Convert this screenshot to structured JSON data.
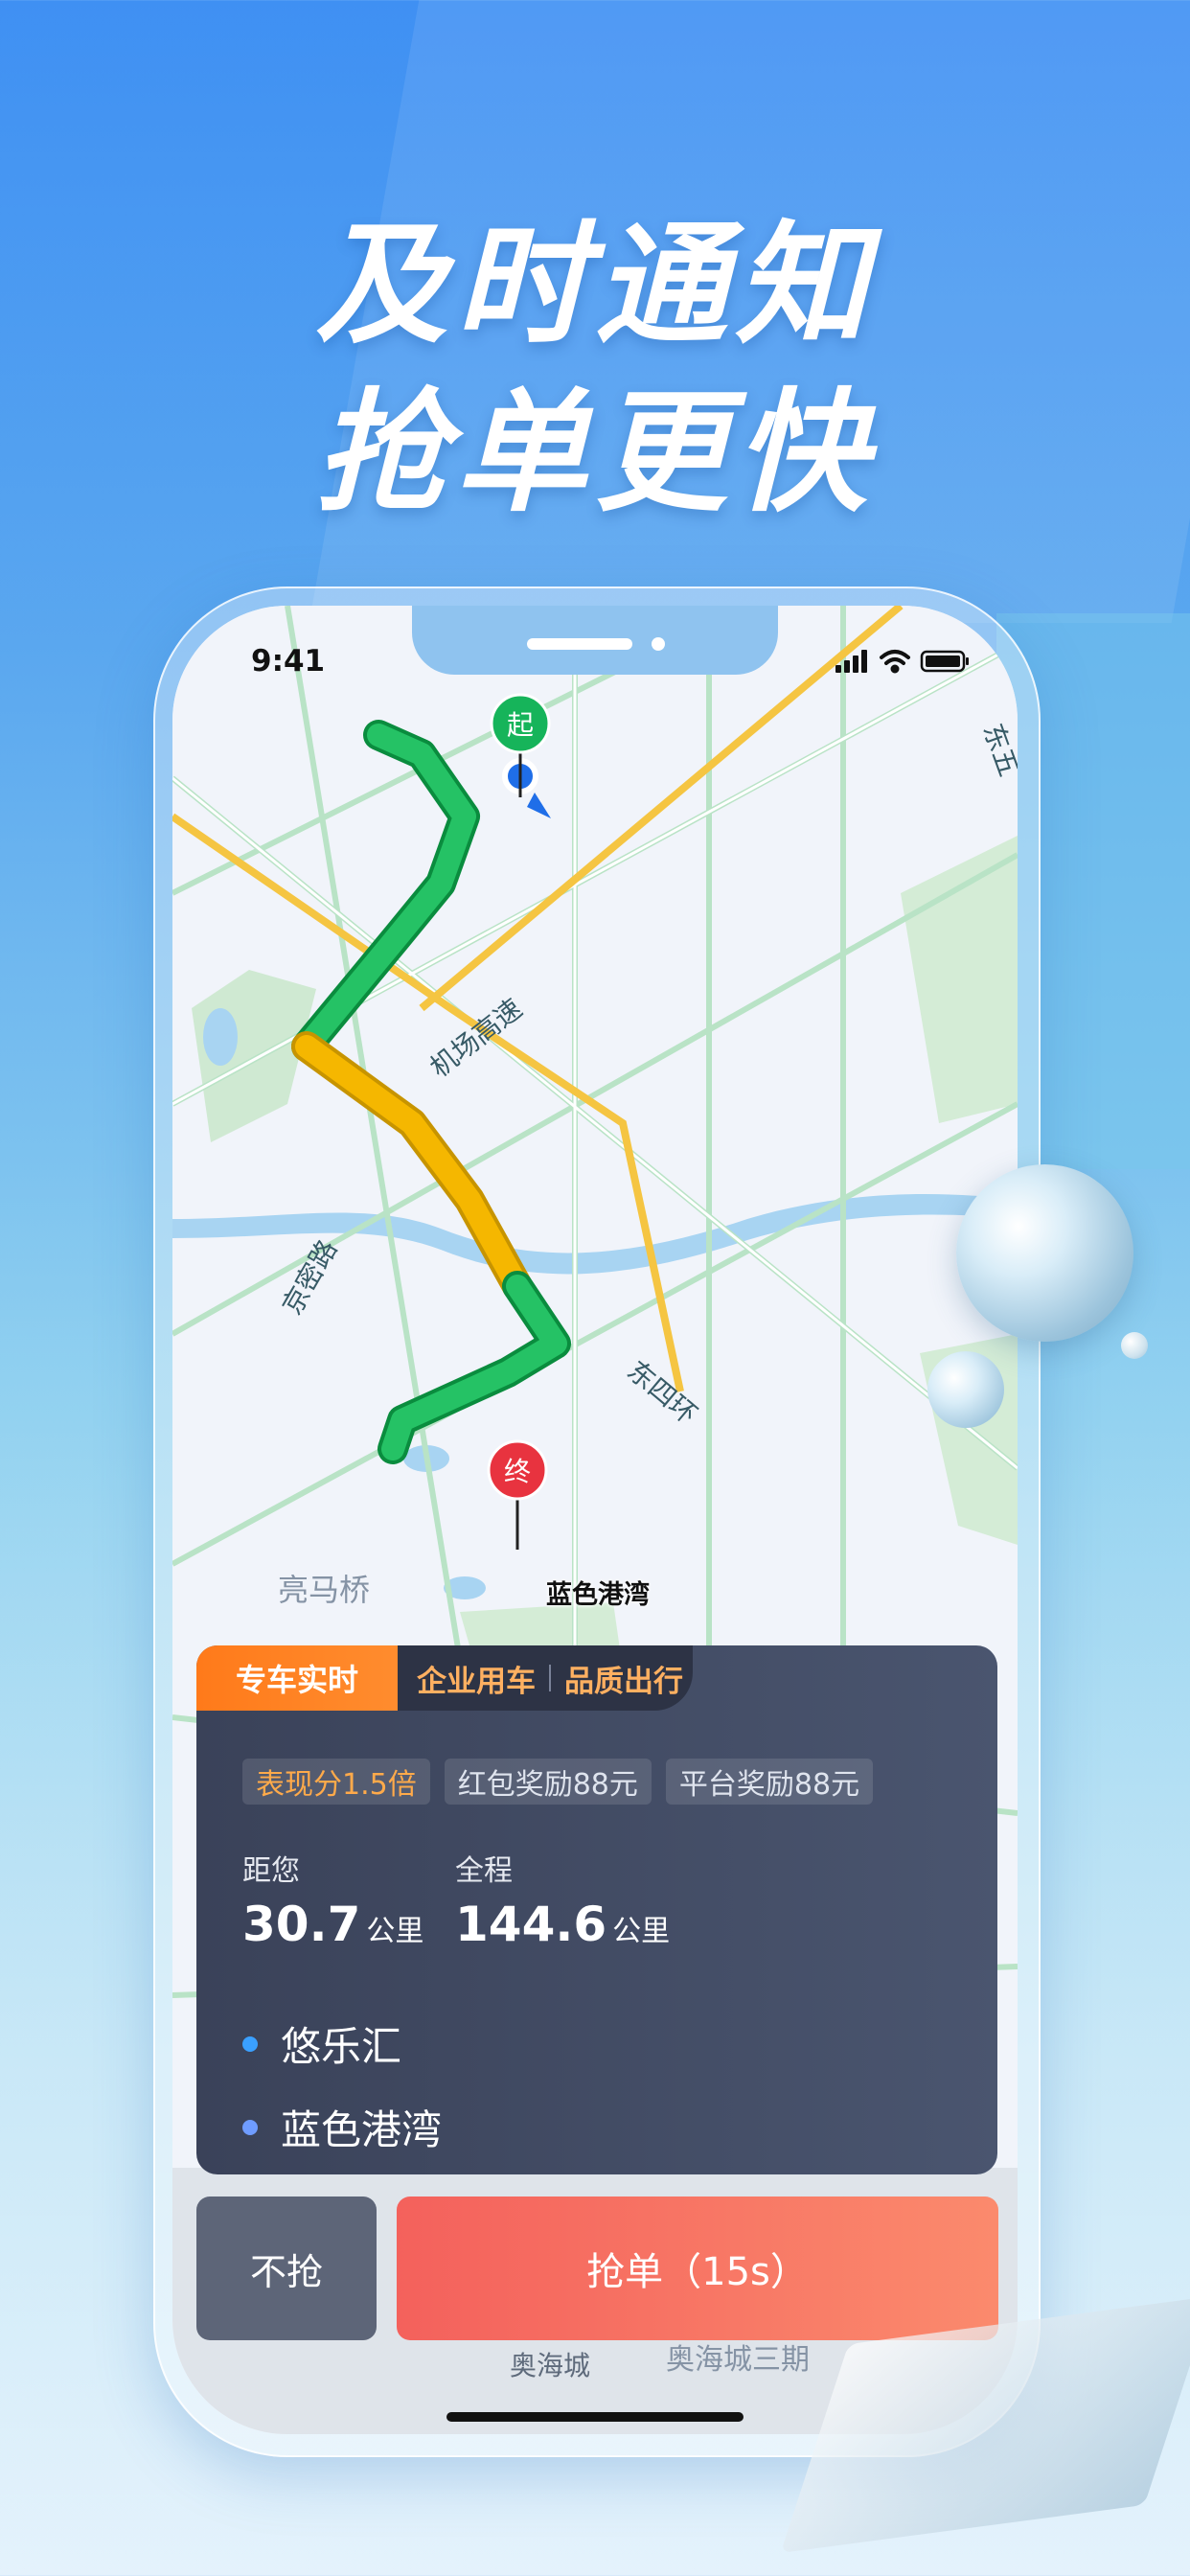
{
  "headline": {
    "line1": "及时通知",
    "line2": "抢单更快"
  },
  "status_bar": {
    "time": "9:41"
  },
  "map": {
    "start_marker": "起",
    "end_marker": "终",
    "destination_label": "蓝色港湾",
    "labels": {
      "airport_expressway": "机场高速",
      "jingmi_road": "京密路",
      "east_fourth_ring": "东四环",
      "liangma_bridge": "亮马桥",
      "aohai_city": "奥海城",
      "aohai_city_3": "奥海城三期",
      "east_5_partial": "东五"
    }
  },
  "order": {
    "tab_active": "专车实时",
    "tab_enterprise": "企业用车",
    "tab_quality": "品质出行",
    "tags": [
      "表现分1.5倍",
      "红包奖励88元",
      "平台奖励88元"
    ],
    "distance_to_you_label": "距您",
    "distance_to_you_value": "30.7",
    "distance_unit": "公里",
    "total_label": "全程",
    "total_value": "144.6",
    "start_point": "悠乐汇",
    "end_point": "蓝色港湾"
  },
  "actions": {
    "skip": "不抢",
    "grab": "抢单（15s）"
  },
  "colors": {
    "accent_orange": "#ff7a1a",
    "grab_red": "#f4615c",
    "route_green": "#1fb25a",
    "route_yellow": "#f5b700"
  }
}
